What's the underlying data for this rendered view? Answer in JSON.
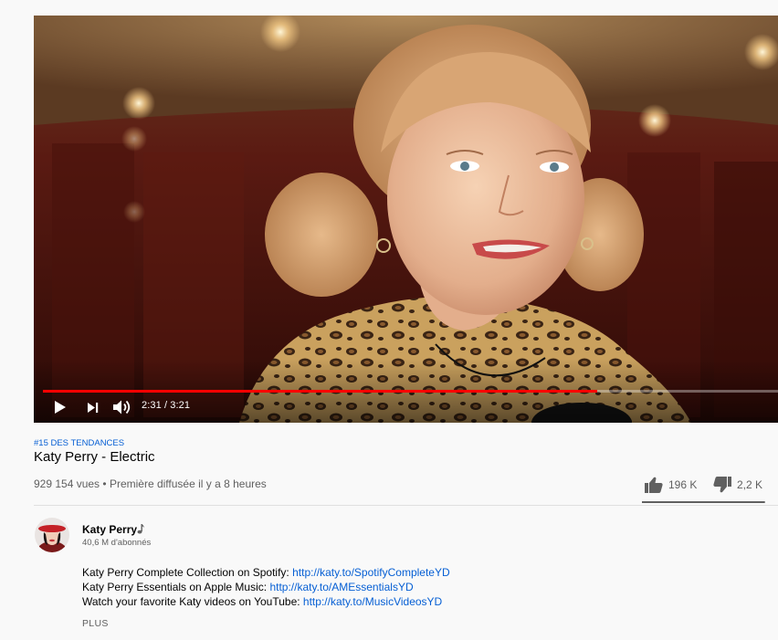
{
  "player": {
    "time": "2:31 / 3:21",
    "progress_fraction": 0.754,
    "progress_color": "#ff0000"
  },
  "video": {
    "hashtag": "#15 DES TENDANCES",
    "title": "Katy Perry - Electric",
    "views": "929 154 vues",
    "separator": " • ",
    "premiere": "Première diffusée il y a 8 heures",
    "likes": "196 K",
    "dislikes": "2,2 K",
    "like_fraction": 0.989
  },
  "channel": {
    "name": "Katy Perry",
    "badge_icon": "music-note-icon",
    "subscribers": "40,6 M d'abonnés"
  },
  "description": {
    "lines": [
      {
        "text": "Katy Perry Complete Collection on Spotify: ",
        "link": "http://katy.to/SpotifyCompleteYD"
      },
      {
        "text": "Katy Perry Essentials on Apple Music: ",
        "link": "http://katy.to/AMEssentialsYD"
      },
      {
        "text": "Watch your favorite Katy videos on YouTube: ",
        "link": "http://katy.to/MusicVideosYD"
      }
    ],
    "more_label": "PLUS"
  },
  "colors": {
    "link": "#065fd4",
    "secondary_text": "#606060",
    "background": "#f9f9f9"
  }
}
